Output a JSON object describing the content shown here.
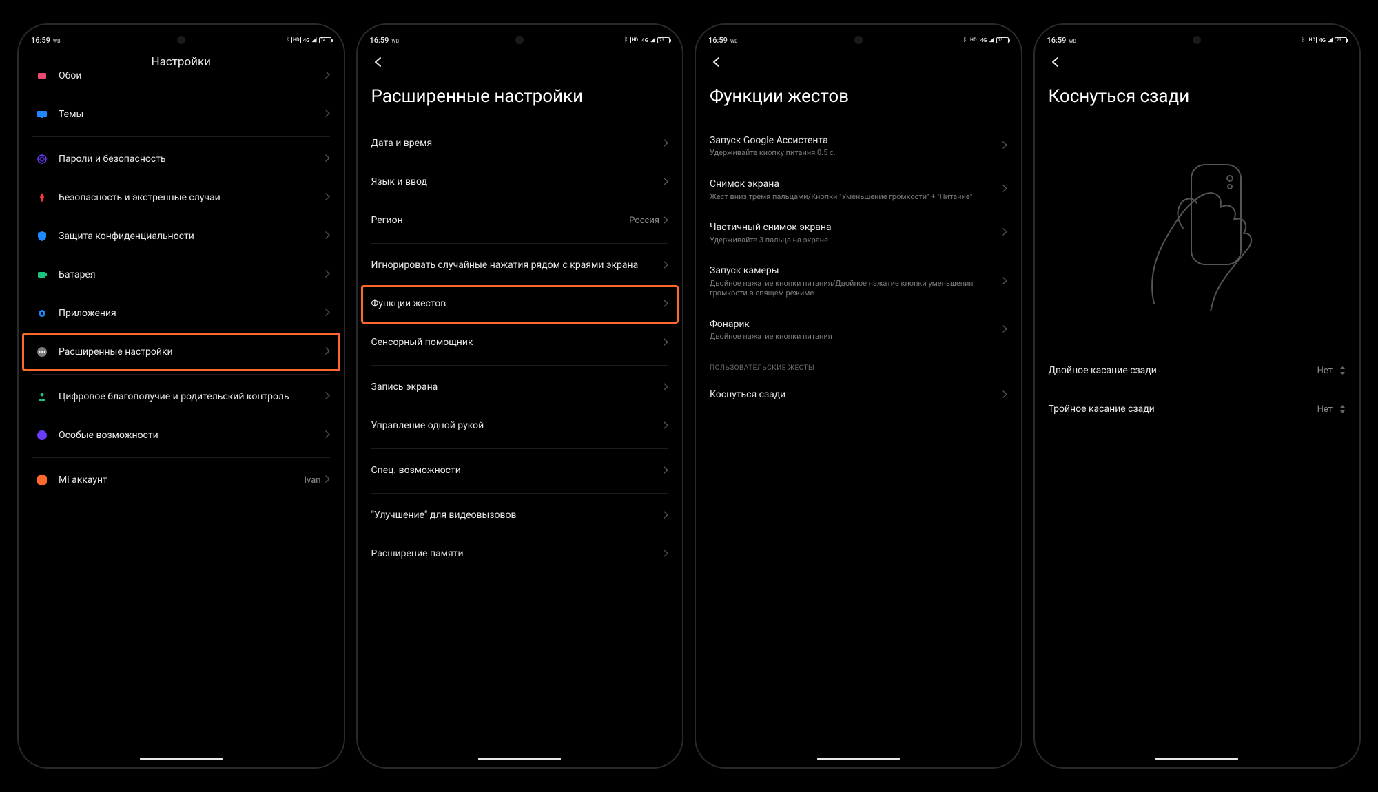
{
  "status": {
    "time": "16:59",
    "wb": "WB",
    "battery": {
      "0": "74",
      "1": "73",
      "2": "73",
      "3": "73"
    },
    "net": "4G"
  },
  "screens": [
    {
      "title_centered": "Настройки",
      "highlight_index": 7,
      "items": [
        {
          "icon": "wallpaper",
          "label": "Обои",
          "color": "#e84a6f",
          "cropped": true
        },
        {
          "icon": "themes",
          "label": "Темы",
          "color": "#1e88ff"
        },
        {
          "divider": true
        },
        {
          "icon": "fingerprint",
          "label": "Пароли и безопасность",
          "color": "#6b3bff"
        },
        {
          "icon": "sos",
          "label": "Безопасность и экстренные случаи",
          "color": "#ff3b30"
        },
        {
          "icon": "shield",
          "label": "Защита конфиденциальности",
          "color": "#1e88ff"
        },
        {
          "icon": "battery",
          "label": "Батарея",
          "color": "#19c37d"
        },
        {
          "icon": "gear",
          "label": "Приложения",
          "color": "#1e88ff"
        },
        {
          "icon": "more",
          "label": "Расширенные настройки",
          "color": "#7a7a7a"
        },
        {
          "divider": true
        },
        {
          "icon": "family",
          "label": "Цифровое благополучие и родительский контроль",
          "color": "#19c37d"
        },
        {
          "icon": "accessibility",
          "label": "Особые возможности",
          "color": "#6b3bff"
        },
        {
          "divider": true
        },
        {
          "icon": "mi",
          "label": "Mi аккаунт",
          "value": "Ivan",
          "color": "#ff6a2b"
        }
      ]
    },
    {
      "back": true,
      "page_title": "Расширенные настройки",
      "highlight_index": 4,
      "items": [
        {
          "label": "Дата и время"
        },
        {
          "label": "Язык и ввод"
        },
        {
          "label": "Регион",
          "value": "Россия"
        },
        {
          "divider": true
        },
        {
          "label": "Игнорировать случайные нажатия рядом с краями экрана"
        },
        {
          "label": "Функции жестов"
        },
        {
          "label": "Сенсорный помощник"
        },
        {
          "divider": true
        },
        {
          "label": "Запись экрана"
        },
        {
          "label": "Управление одной рукой"
        },
        {
          "divider": true
        },
        {
          "label": "Спец. возможности"
        },
        {
          "divider": true
        },
        {
          "label": "\"Улучшение\" для видеовызовов"
        },
        {
          "label": "Расширение памяти",
          "cropped_bot": true
        }
      ]
    },
    {
      "back": true,
      "page_title": "Функции жестов",
      "highlight_index": 6,
      "items": [
        {
          "label": "Запуск Google Ассистента",
          "sub": "Удерживайте кнопку питания 0.5 с."
        },
        {
          "label": "Снимок экрана",
          "sub": "Жест вниз тремя пальцами/Кнопки \"Уменьшение громкости\" + \"Питание\""
        },
        {
          "label": "Частичный снимок экрана",
          "sub": "Удерживайте 3 пальца на экране"
        },
        {
          "label": "Запуск камеры",
          "sub": "Двойное нажатие кнопки питания/Двойное нажатие кнопки уменьшения громкости в спящем режиме"
        },
        {
          "label": "Фонарик",
          "sub": "Двойное нажатие кнопки питания"
        },
        {
          "section": "ПОЛЬЗОВАТЕЛЬСКИЕ ЖЕСТЫ"
        },
        {
          "label": "Коснуться сзади"
        }
      ]
    },
    {
      "back": true,
      "page_title": "Коснуться сзади",
      "illustration": true,
      "items": [
        {
          "label": "Двойное касание сзади",
          "value": "Нет",
          "updown": true
        },
        {
          "label": "Тройное касание сзади",
          "value": "Нет",
          "updown": true
        }
      ]
    }
  ]
}
